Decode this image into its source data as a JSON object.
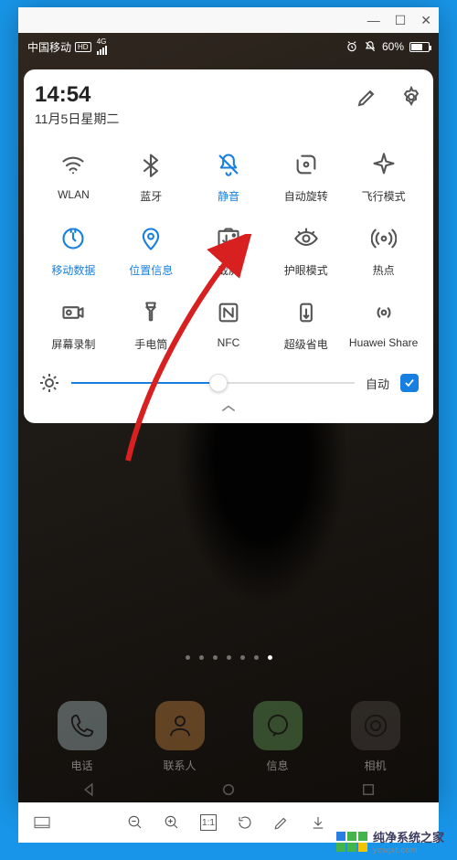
{
  "status_bar": {
    "carrier": "中国移动",
    "net_badge": "HD",
    "net_type": "4G",
    "battery_text": "60%"
  },
  "panel": {
    "time": "14:54",
    "date": "11月5日星期二",
    "auto_label": "自动"
  },
  "tiles": [
    {
      "id": "wlan",
      "label": "WLAN",
      "active": false
    },
    {
      "id": "bt",
      "label": "蓝牙",
      "active": false
    },
    {
      "id": "mute",
      "label": "静音",
      "active": true
    },
    {
      "id": "rotate",
      "label": "自动旋转",
      "active": false
    },
    {
      "id": "airplane",
      "label": "飞行模式",
      "active": false
    },
    {
      "id": "data",
      "label": "移动数据",
      "active": true
    },
    {
      "id": "loc",
      "label": "位置信息",
      "active": true
    },
    {
      "id": "shot",
      "label": "截屏",
      "active": false
    },
    {
      "id": "eye",
      "label": "护眼模式",
      "active": false
    },
    {
      "id": "hotspot",
      "label": "热点",
      "active": false
    },
    {
      "id": "rec",
      "label": "屏幕录制",
      "active": false
    },
    {
      "id": "torch",
      "label": "手电筒",
      "active": false
    },
    {
      "id": "nfc",
      "label": "NFC",
      "active": false
    },
    {
      "id": "save",
      "label": "超级省电",
      "active": false
    },
    {
      "id": "share",
      "label": "Huawei Share",
      "active": false
    }
  ],
  "dock": [
    {
      "label": "电话"
    },
    {
      "label": "联系人"
    },
    {
      "label": "信息"
    },
    {
      "label": "相机"
    }
  ],
  "viewer_toolbar": {
    "zoom_value": "1:1"
  },
  "watermark": {
    "text": "纯净系统之家",
    "url": "ycwjxt.com"
  }
}
